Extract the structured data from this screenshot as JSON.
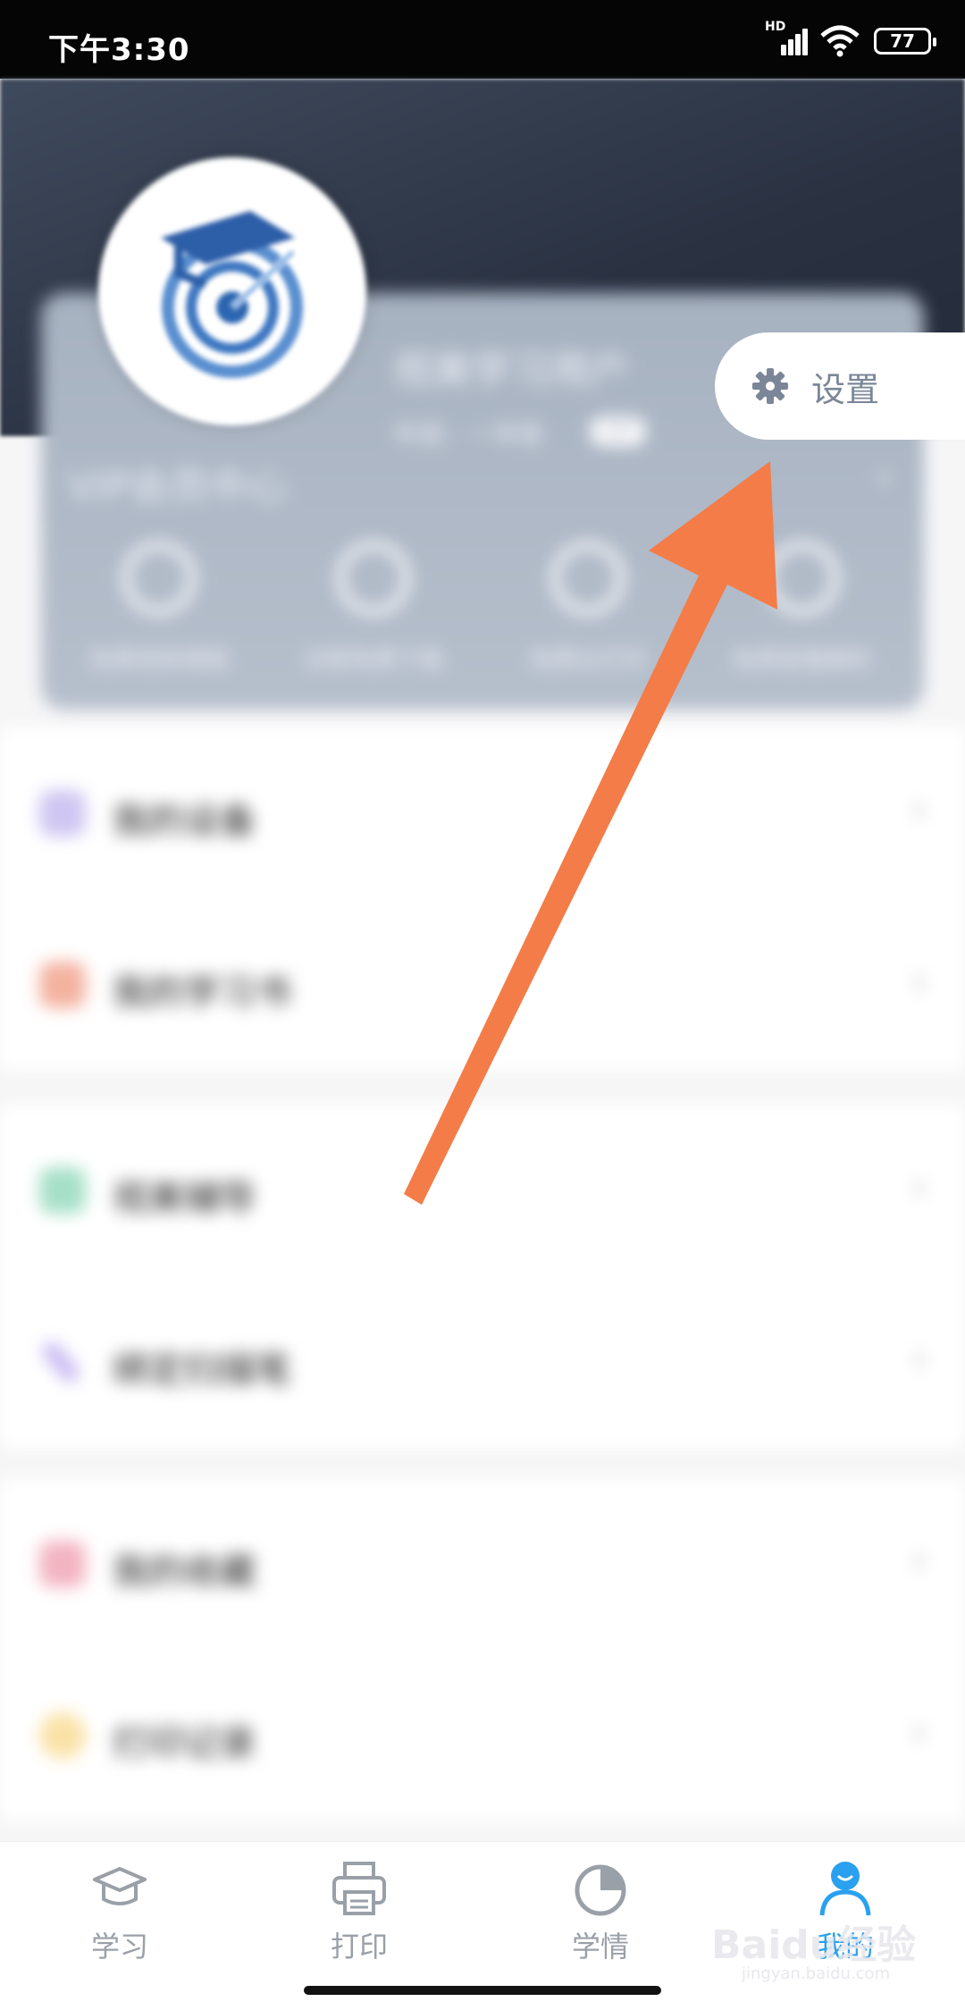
{
  "status_bar": {
    "time": "下午3:30",
    "network": "HD",
    "battery": "77"
  },
  "profile": {
    "name": "视美学习用户",
    "grade": "年级：一年级",
    "badge": "VIP"
  },
  "vip": {
    "title": "VIP会员中心",
    "benefits": [
      {
        "label": "免费视频课程"
      },
      {
        "label": "试卷免费下载"
      },
      {
        "label": "免费云打印"
      },
      {
        "label": "免费查看解析"
      }
    ]
  },
  "settings": {
    "label": "设置"
  },
  "menu_groups": [
    {
      "items": [
        {
          "label": "我的设备",
          "color": "#cfc6f2"
        },
        {
          "label": "我的学习书",
          "color": "#f4b2a0"
        }
      ]
    },
    {
      "items": [
        {
          "label": "视美辅导",
          "color": "#a6e0c8"
        },
        {
          "label": "绑定扫描笔",
          "color": "#c7b9f3"
        }
      ]
    },
    {
      "items": [
        {
          "label": "我的收藏",
          "color": "#f3b4c2"
        },
        {
          "label": "打印记录",
          "color": "#fae2a6"
        }
      ]
    }
  ],
  "tabs": [
    {
      "label": "学习",
      "icon": "graduation-cap-icon"
    },
    {
      "label": "打印",
      "icon": "printer-icon"
    },
    {
      "label": "学情",
      "icon": "pie-chart-icon"
    },
    {
      "label": "我的",
      "icon": "user-icon",
      "active": true
    }
  ],
  "watermark": {
    "text": "Baidu经验",
    "sub": "jingyan.baidu.com"
  },
  "colors": {
    "accent": "#2aa0ef",
    "arrow": "#f47c48"
  }
}
